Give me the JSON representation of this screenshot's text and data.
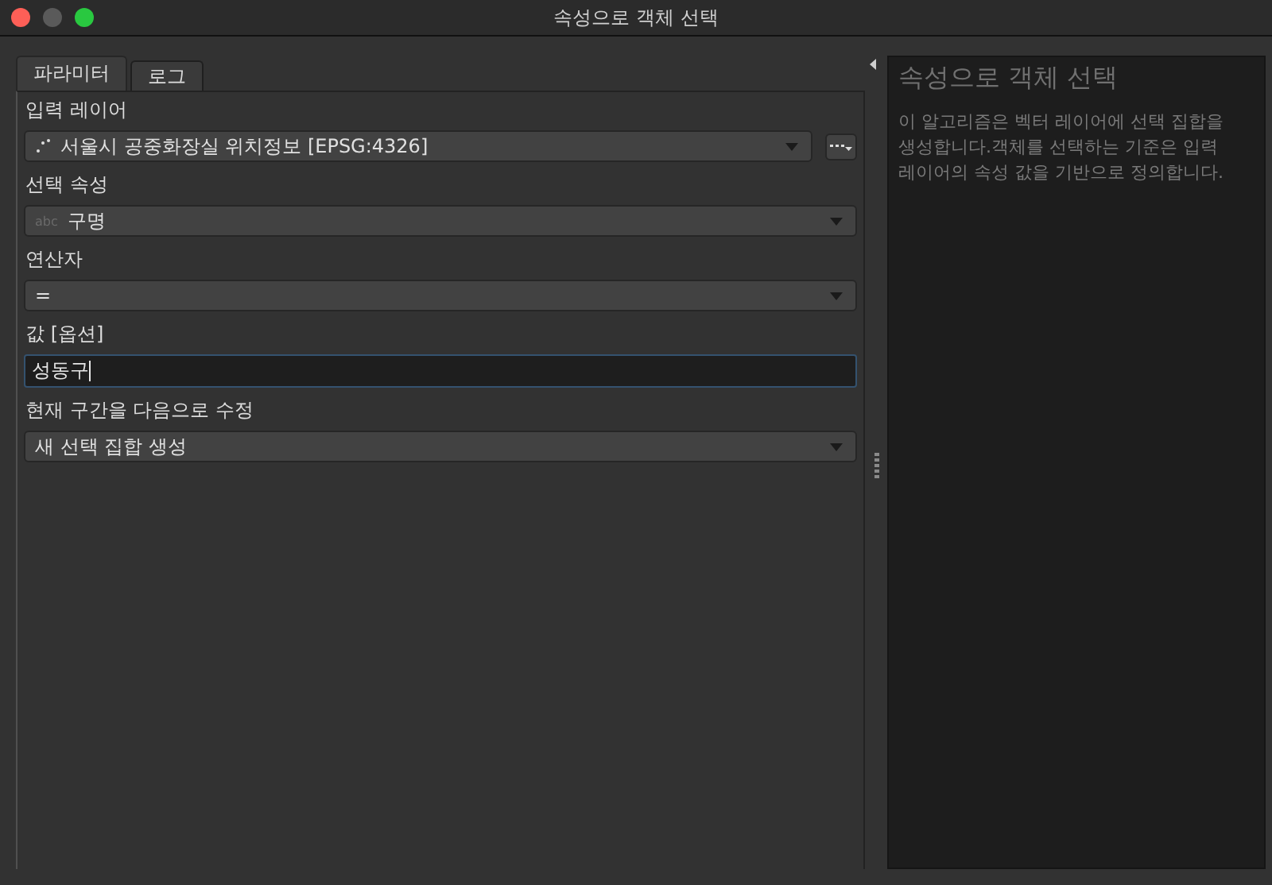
{
  "window": {
    "title": "속성으로 객체 선택"
  },
  "tabs": [
    {
      "label": "파라미터",
      "selected": true
    },
    {
      "label": "로그",
      "selected": false
    }
  ],
  "params": [
    {
      "label": "입력 레이어",
      "kind": "layer_combo",
      "value": "서울시 공중화장실 위치정보 [EPSG:4326]"
    },
    {
      "label": "선택 속성",
      "kind": "field_combo",
      "type_tag": "abc",
      "value": "구명"
    },
    {
      "label": "연산자",
      "kind": "combo",
      "value": "="
    },
    {
      "label": "값 [옵션]",
      "kind": "text",
      "value": "성동구",
      "focused": true
    },
    {
      "label": "현재 구간을 다음으로 수정",
      "kind": "combo",
      "value": "새 선택 집합 생성"
    }
  ],
  "help": {
    "title": "속성으로 객체 선택",
    "text": "이 알고리즘은 벡터 레이어에 선택 집합을 생성합니다.객체를 선택하는 기준은 입력 레이어의 속성 값을 기반으로 정의합니다."
  }
}
